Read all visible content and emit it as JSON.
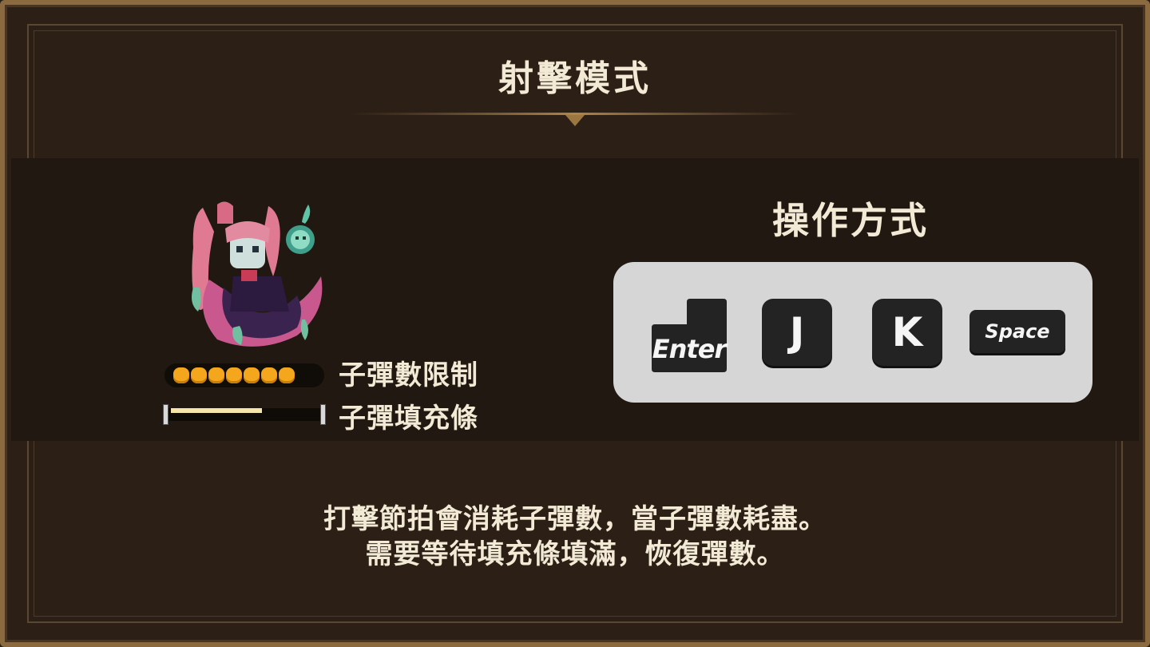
{
  "title": "射擊模式",
  "mechanics": {
    "ammo_limit_label": "子彈數限制",
    "refill_bar_label": "子彈填充條",
    "ammo_count": 7,
    "refill_level": 0.62
  },
  "controls": {
    "title": "操作方式",
    "keys": [
      "Enter",
      "J",
      "K",
      "Space"
    ]
  },
  "description": {
    "line1": "打擊節拍會消耗子彈數，當子彈數耗盡。",
    "line2": "需要等待填充條填滿，恢復彈數。"
  },
  "colors": {
    "frame": "#8a6a3e",
    "background": "#2c2016",
    "band": "#211811",
    "text": "#f3ead6",
    "ammo": "#f4a61c",
    "refill": "#f4e6a8",
    "key_panel": "#d6d6d6",
    "key": "#232323"
  }
}
